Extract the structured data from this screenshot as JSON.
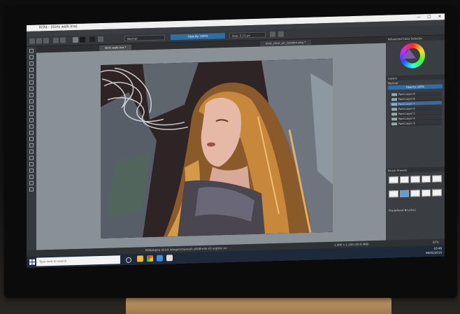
{
  "window": {
    "title": "Krita - [Girls walk.kra]",
    "controls": [
      "—",
      "☐",
      "✕"
    ]
  },
  "menu": [
    "File",
    "Edit",
    "View",
    "Image",
    "Layer",
    "Select",
    "Filter",
    "Tools",
    "Settings",
    "Window",
    "Help"
  ],
  "toolbar": {
    "blend_mode": "Normal",
    "opacity": "Opacity: 100%",
    "size": "Size: 5.11 px"
  },
  "tabs": [
    {
      "label": "Girls walk.kra *",
      "active": true
    },
    {
      "label": "dust_clear_on_random.png *",
      "active": false
    }
  ],
  "dock": {
    "color_header": "Advanced Color Selector",
    "layers_header": "Layers",
    "layers_blend": "Normal",
    "layers_opacity": "Opacity: 100%",
    "layers": [
      {
        "name": "Paint Layer 9",
        "selected": false
      },
      {
        "name": "Paint Layer 8",
        "selected": false
      },
      {
        "name": "Paint Layer 7",
        "selected": true
      },
      {
        "name": "Paint Layer 6",
        "selected": false
      },
      {
        "name": "Paint Layer 5",
        "selected": false
      },
      {
        "name": "Paint Layer 4",
        "selected": false
      },
      {
        "name": "Paint Layer 3",
        "selected": false
      }
    ],
    "brush_header": "Brush Presets",
    "brush_tag": "Predefined Brushes"
  },
  "status": {
    "left": "RGB/Alpha (8-bit integer/channel)  sRGB-elle-V2-srgbtrc.icc",
    "right": "1,400 x 1,200 (30.6 MiB)",
    "zoom": "67%"
  },
  "taskbar": {
    "search_placeholder": "Type here to search",
    "time": "10:48",
    "date": "06/02/2019"
  }
}
